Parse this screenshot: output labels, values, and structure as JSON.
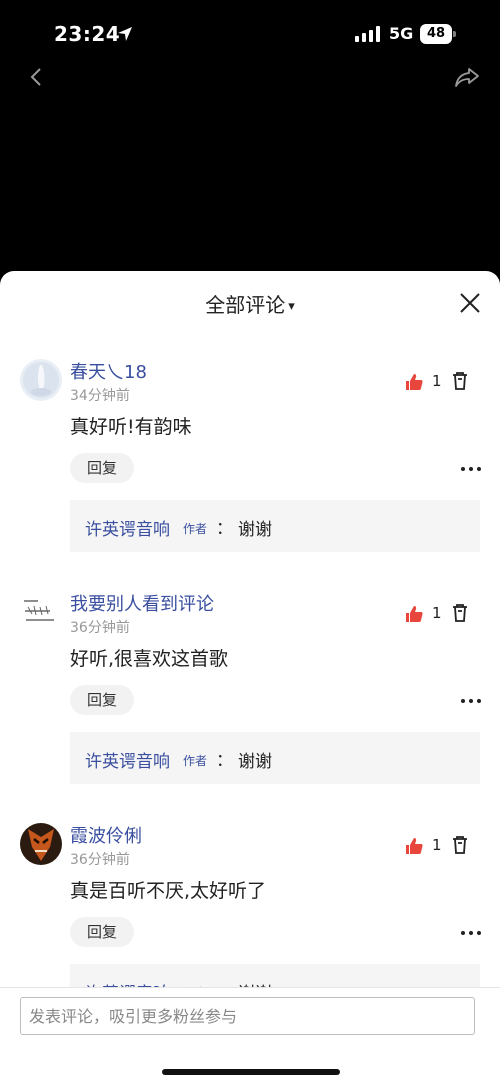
{
  "status_bar": {
    "time": "23:24",
    "network": "5G",
    "battery": "48"
  },
  "sheet": {
    "title": "全部评论",
    "caret": "▾"
  },
  "comments": [
    {
      "username": "春天乀18",
      "time": "34分钟前",
      "text": "真好听!有韵味",
      "likes": "1",
      "reply_label": "回复",
      "reply": {
        "author": "许英谔音响",
        "badge": "作者",
        "colon": "：",
        "text": "谢谢"
      }
    },
    {
      "username": "我要别人看到评论",
      "time": "36分钟前",
      "text": "好听,很喜欢这首歌",
      "likes": "1",
      "reply_label": "回复",
      "reply": {
        "author": "许英谔音响",
        "badge": "作者",
        "colon": "：",
        "text": "谢谢"
      }
    },
    {
      "username": "霞波伶俐",
      "time": "36分钟前",
      "text": "真是百听不厌,太好听了",
      "likes": "1",
      "reply_label": "回复",
      "reply": {
        "author": "许英谔音响",
        "badge": "作者",
        "colon": "：",
        "text": "谢谢"
      }
    }
  ],
  "composer": {
    "placeholder": "发表评论，吸引更多粉丝参与"
  },
  "colors": {
    "username": "#3a4fa0",
    "like": "#e8453c"
  }
}
